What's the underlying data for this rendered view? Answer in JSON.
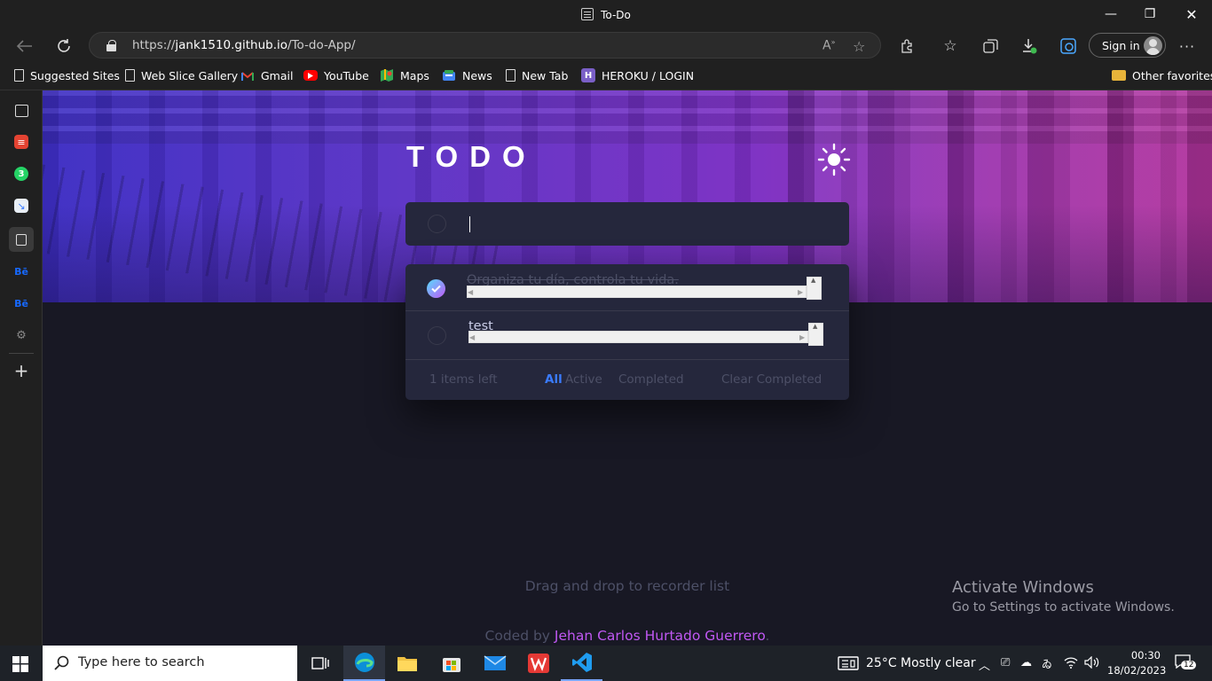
{
  "window": {
    "title": "To-Do",
    "controls": {
      "minimize": "—",
      "restore": "❐",
      "close": "✕"
    }
  },
  "browser": {
    "url_prefix": "https://",
    "url_domain": "jank1510.github.io",
    "url_path": "/To-do-App/",
    "signin_label": "Sign in",
    "favorites": [
      {
        "label": "Suggested Sites",
        "icon": "page-icon"
      },
      {
        "label": "Web Slice Gallery",
        "icon": "page-icon"
      },
      {
        "label": "Gmail",
        "icon": "gmail-icon"
      },
      {
        "label": "YouTube",
        "icon": "youtube-icon"
      },
      {
        "label": "Maps",
        "icon": "maps-icon"
      },
      {
        "label": "News",
        "icon": "news-icon"
      },
      {
        "label": "New Tab",
        "icon": "page-icon"
      },
      {
        "label": "HEROKU / LOGIN",
        "icon": "heroku-icon"
      }
    ],
    "other_favorites": "Other favorites",
    "sidebar_badge": "3"
  },
  "app": {
    "title": "TODO",
    "new_todo_value": "",
    "todos": [
      {
        "text": "Organiza tu día, controla tu vida.",
        "completed": true
      },
      {
        "text": "test",
        "completed": false
      }
    ],
    "footer": {
      "items_left": "1 items left",
      "filters": [
        "All",
        "Active",
        "Completed"
      ],
      "active_filter": "All",
      "clear": "Clear Completed"
    },
    "hint": "Drag and drop to recorder list",
    "credit_prefix": "Coded by",
    "credit_author": "Jehan Carlos Hurtado Guerrero",
    "credit_suffix": "."
  },
  "watermark": {
    "heading": "Activate Windows",
    "sub": "Go to Settings to activate Windows."
  },
  "taskbar": {
    "search_placeholder": "Type here to search",
    "weather": "25°C  Mostly clear",
    "time": "00:30",
    "date": "18/02/2023",
    "notification_count": "12"
  },
  "colors": {
    "accent_blue": "#3a7bfd",
    "accent_purple": "#c058f3",
    "card": "#25273c",
    "page_bg": "#181824"
  }
}
